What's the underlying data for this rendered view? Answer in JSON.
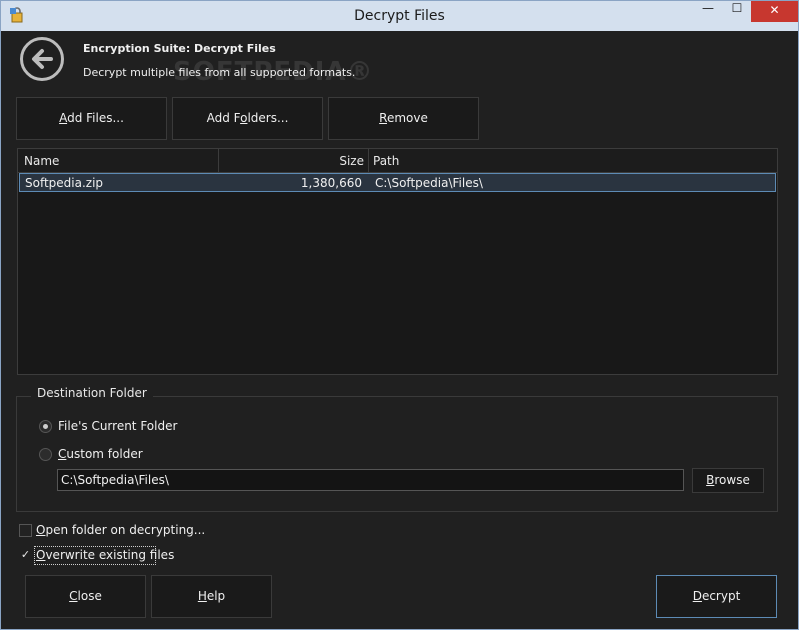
{
  "window": {
    "title": "Decrypt Files",
    "min_glyph": "—",
    "max_glyph": "☐",
    "close_glyph": "✕"
  },
  "header": {
    "title": "Encryption Suite: Decrypt Files",
    "subtitle": "Decrypt multiple files from all supported formats.",
    "watermark": "SOFTPEDIA®"
  },
  "toolbar": {
    "add_files_u": "A",
    "add_files_rest": "dd Files...",
    "add_folders_pre": "Add F",
    "add_folders_u": "o",
    "add_folders_rest": "lders...",
    "remove_u": "R",
    "remove_rest": "emove"
  },
  "file_list": {
    "columns": [
      "Name",
      "Size",
      "Path"
    ],
    "rows": [
      {
        "name": "Softpedia.zip",
        "size": "1,380,660",
        "path": "C:\\Softpedia\\Files\\"
      }
    ]
  },
  "destination": {
    "legend": "Destination Folder",
    "option_current": "File's Current Folder",
    "option_custom_u": "C",
    "option_custom_rest": "ustom folder",
    "selected": "File's Current Folder",
    "custom_path": "C:\\Softpedia\\Files\\",
    "browse_u": "B",
    "browse_rest": "rowse"
  },
  "options": {
    "open_folder_u": "O",
    "open_folder_rest": "pen folder on decrypting...",
    "open_folder_checked": false,
    "overwrite_u": "O",
    "overwrite_rest": "verwrite existing files",
    "overwrite_checked": true,
    "check_glyph": "✓"
  },
  "footer": {
    "close_u": "C",
    "close_rest": "lose",
    "help_u": "H",
    "help_rest": "elp",
    "decrypt_u": "D",
    "decrypt_rest": "ecrypt"
  },
  "colors": {
    "background": "#202020",
    "selection": "#2a3440",
    "selection_border": "#5d8bb5",
    "titlebar": "#d4e0ee",
    "close_red": "#c7372f"
  }
}
